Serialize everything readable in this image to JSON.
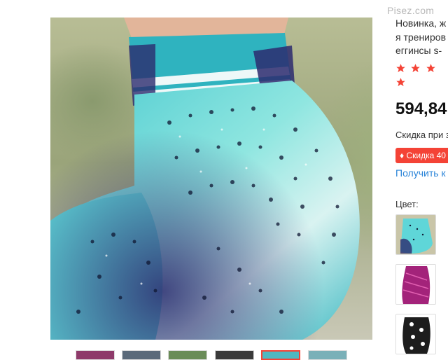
{
  "watermark": "Pisez.com",
  "product": {
    "title_lines": [
      "Новинка, ж",
      "я трениров",
      "еггинсы s-"
    ],
    "rating_stars": 4,
    "price": "594,84",
    "discount_text": "Скидка при з",
    "badge_label": "Скидка 40",
    "coupon_link": "Получить к",
    "color_label": "Цвет:"
  },
  "colors": {
    "star": "#f44336",
    "badge_bg": "#f44336",
    "link": "#2a84d8",
    "leggings_main": "#5fd6d8",
    "leggings_dark": "#2c2a6e"
  },
  "swatches": [
    {
      "name": "teal-dewdrop"
    },
    {
      "name": "magenta-pattern"
    },
    {
      "name": "black-white-dots"
    }
  ],
  "thumbnails": [
    {
      "name": "thumb-1",
      "active": false
    },
    {
      "name": "thumb-2",
      "active": false
    },
    {
      "name": "thumb-3",
      "active": false
    },
    {
      "name": "thumb-4",
      "active": false
    },
    {
      "name": "thumb-5",
      "active": true
    },
    {
      "name": "thumb-6",
      "active": false
    }
  ]
}
